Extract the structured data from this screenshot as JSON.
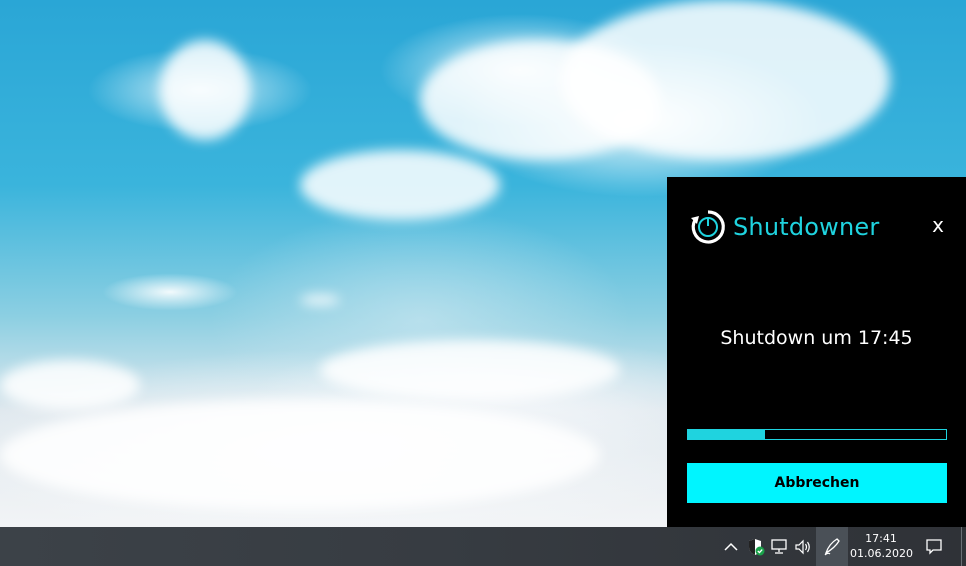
{
  "app": {
    "title": "Shutdowner",
    "close_label": "x",
    "status": "Shutdown um 17:45",
    "progress": 0.3,
    "cancel_label": "Abbrechen",
    "accent_color": "#1fd3df",
    "button_color": "#00f5ff"
  },
  "taskbar": {
    "tray_icons": [
      "chevron-up-icon",
      "shield-icon",
      "network-icon",
      "volume-icon",
      "pen-icon"
    ],
    "clock": {
      "time": "17:41",
      "date": "01.06.2020"
    },
    "notification_icon": "notification-icon"
  }
}
